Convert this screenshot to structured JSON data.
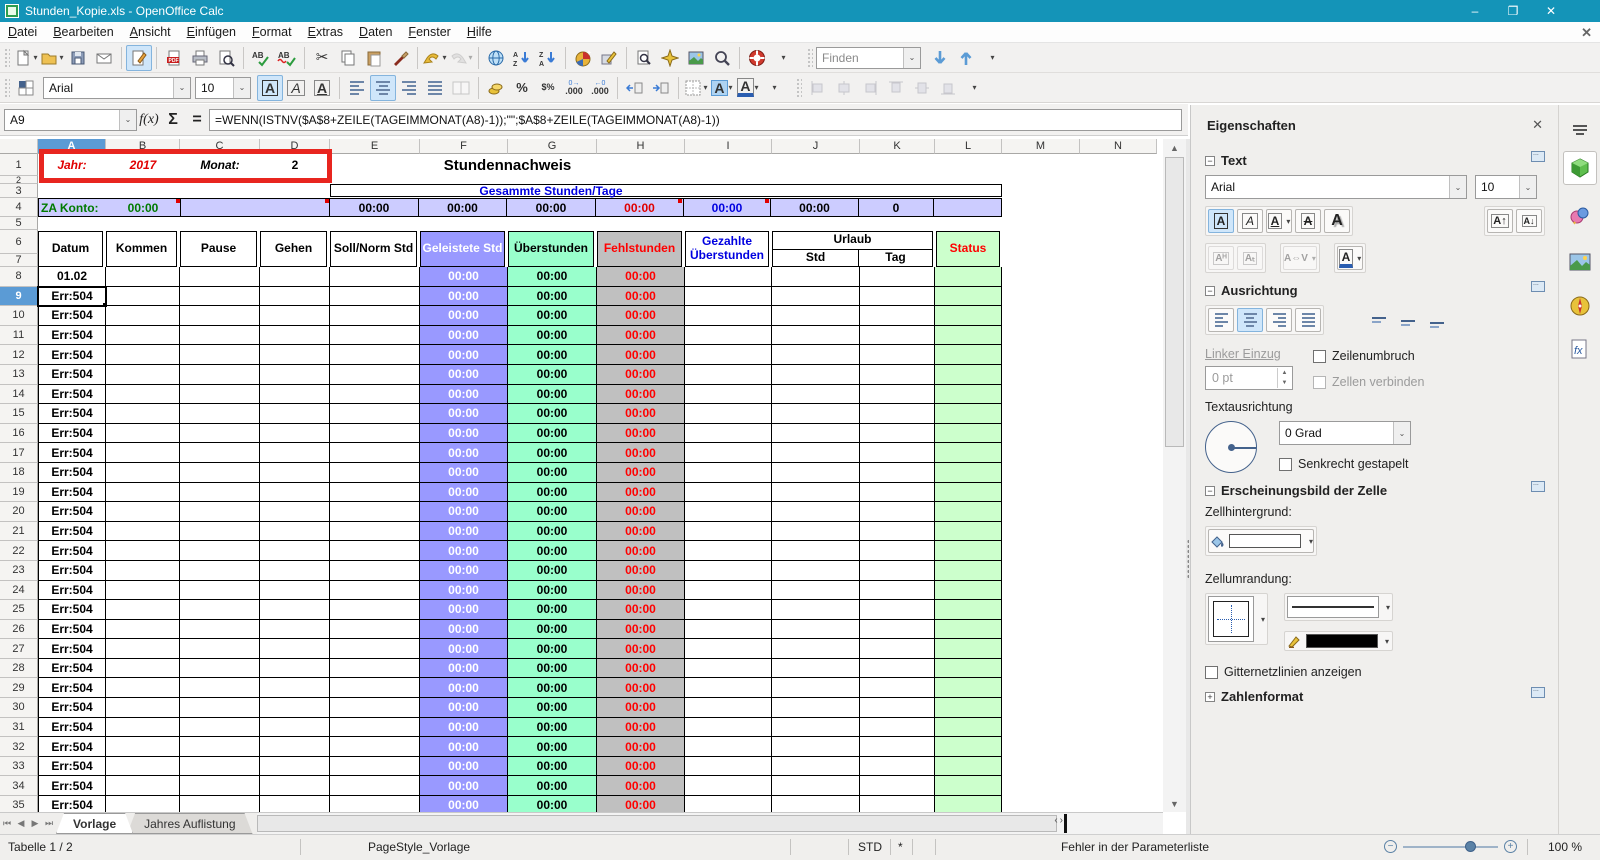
{
  "window": {
    "title": "Stunden_Kopie.xls - OpenOffice Calc",
    "minimize": "–",
    "restore": "❐",
    "close": "✕"
  },
  "menu": {
    "items": [
      "Datei",
      "Bearbeiten",
      "Ansicht",
      "Einfügen",
      "Format",
      "Extras",
      "Daten",
      "Fenster",
      "Hilfe"
    ],
    "doc_close": "✕"
  },
  "standard_toolbar_icons": [
    "new-document",
    "open",
    "save",
    "email",
    "edit-file",
    "export-pdf",
    "print",
    "page-preview",
    "spellcheck",
    "auto-spellcheck",
    "cut",
    "copy",
    "paste",
    "format-paintbrush",
    "undo",
    "redo",
    "hyperlink",
    "sort-ascending",
    "sort-descending",
    "insert-chart",
    "draw-functions",
    "find-replace",
    "navigator",
    "gallery",
    "zoom",
    "help"
  ],
  "find_toolbar": {
    "placeholder": "Finden",
    "find_down": "find-down-arrow",
    "find_up": "find-up-arrow"
  },
  "formatting": {
    "font_name": "Arial",
    "font_size": "10",
    "bold": "A",
    "italic": "A",
    "underline": "A",
    "percent": "%",
    "standard_format": "$%",
    "add_decimal": ".000",
    "del_decimal": ".000",
    "bg_color_letter": "A",
    "font_color_letter": "A"
  },
  "formula_bar": {
    "cell_reference": "A9",
    "fx": "f(x)",
    "sum": "Σ",
    "equals": "=",
    "formula": "=WENN(ISTNV($A$8+ZEILE(TAGEIMMONAT(A8)-1));\"\";$A$8+ZEILE(TAGEIMMONAT(A8)-1))"
  },
  "columns": [
    "A",
    "B",
    "C",
    "D",
    "E",
    "F",
    "G",
    "H",
    "I",
    "J",
    "K",
    "L",
    "M",
    "N"
  ],
  "sheet": {
    "fixed_row_numbers": [
      "1",
      "2",
      "3",
      "4",
      "5",
      "6",
      "7"
    ],
    "title_row": {
      "jahr_label": "Jahr:",
      "jahr_value": "2017",
      "monat_label": "Monat:",
      "monat_value": "2",
      "doc_title": "Stundennachweis"
    },
    "summary": {
      "header": "Gesammte Stunden/Tage",
      "za_label": "ZA Konto:",
      "za_value": "00:00",
      "value_e": "00:00",
      "value_f": "00:00",
      "value_g": "00:00",
      "value_h": "00:00",
      "value_i": "00:00",
      "value_j": "00:00",
      "value_k": "0"
    },
    "table_headers": {
      "datum": "Datum",
      "kommen": "Kommen",
      "pause": "Pause",
      "gehen": "Gehen",
      "soll": "Soll/Norm Std",
      "geleistete": "Geleistete Std",
      "ueberstunden": "Überstunden",
      "fehlstunden": "Fehlstunden",
      "gezahlte": "Gezahlte Überstunden",
      "urlaub": "Urlaub",
      "std": "Std",
      "tag": "Tag",
      "status": "Status"
    },
    "selected_cell": "A9",
    "rows": [
      {
        "n": 8,
        "a": "01.02",
        "f": "00:00",
        "g": "00:00",
        "h": "00:00"
      },
      {
        "n": 9,
        "a": "Err:504",
        "f": "00:00",
        "g": "00:00",
        "h": "00:00"
      },
      {
        "n": 10,
        "a": "Err:504",
        "f": "00:00",
        "g": "00:00",
        "h": "00:00"
      },
      {
        "n": 11,
        "a": "Err:504",
        "f": "00:00",
        "g": "00:00",
        "h": "00:00"
      },
      {
        "n": 12,
        "a": "Err:504",
        "f": "00:00",
        "g": "00:00",
        "h": "00:00"
      },
      {
        "n": 13,
        "a": "Err:504",
        "f": "00:00",
        "g": "00:00",
        "h": "00:00"
      },
      {
        "n": 14,
        "a": "Err:504",
        "f": "00:00",
        "g": "00:00",
        "h": "00:00"
      },
      {
        "n": 15,
        "a": "Err:504",
        "f": "00:00",
        "g": "00:00",
        "h": "00:00"
      },
      {
        "n": 16,
        "a": "Err:504",
        "f": "00:00",
        "g": "00:00",
        "h": "00:00"
      },
      {
        "n": 17,
        "a": "Err:504",
        "f": "00:00",
        "g": "00:00",
        "h": "00:00"
      },
      {
        "n": 18,
        "a": "Err:504",
        "f": "00:00",
        "g": "00:00",
        "h": "00:00"
      },
      {
        "n": 19,
        "a": "Err:504",
        "f": "00:00",
        "g": "00:00",
        "h": "00:00"
      },
      {
        "n": 20,
        "a": "Err:504",
        "f": "00:00",
        "g": "00:00",
        "h": "00:00"
      },
      {
        "n": 21,
        "a": "Err:504",
        "f": "00:00",
        "g": "00:00",
        "h": "00:00"
      },
      {
        "n": 22,
        "a": "Err:504",
        "f": "00:00",
        "g": "00:00",
        "h": "00:00"
      },
      {
        "n": 23,
        "a": "Err:504",
        "f": "00:00",
        "g": "00:00",
        "h": "00:00"
      },
      {
        "n": 24,
        "a": "Err:504",
        "f": "00:00",
        "g": "00:00",
        "h": "00:00"
      },
      {
        "n": 25,
        "a": "Err:504",
        "f": "00:00",
        "g": "00:00",
        "h": "00:00"
      },
      {
        "n": 26,
        "a": "Err:504",
        "f": "00:00",
        "g": "00:00",
        "h": "00:00"
      },
      {
        "n": 27,
        "a": "Err:504",
        "f": "00:00",
        "g": "00:00",
        "h": "00:00"
      },
      {
        "n": 28,
        "a": "Err:504",
        "f": "00:00",
        "g": "00:00",
        "h": "00:00"
      },
      {
        "n": 29,
        "a": "Err:504",
        "f": "00:00",
        "g": "00:00",
        "h": "00:00"
      },
      {
        "n": 30,
        "a": "Err:504",
        "f": "00:00",
        "g": "00:00",
        "h": "00:00"
      },
      {
        "n": 31,
        "a": "Err:504",
        "f": "00:00",
        "g": "00:00",
        "h": "00:00"
      },
      {
        "n": 32,
        "a": "Err:504",
        "f": "00:00",
        "g": "00:00",
        "h": "00:00"
      },
      {
        "n": 33,
        "a": "Err:504",
        "f": "00:00",
        "g": "00:00",
        "h": "00:00"
      },
      {
        "n": 34,
        "a": "Err:504",
        "f": "00:00",
        "g": "00:00",
        "h": "00:00"
      },
      {
        "n": 35,
        "a": "Err:504",
        "f": "00:00",
        "g": "00:00",
        "h": "00:00"
      }
    ]
  },
  "tabs": {
    "sheets": [
      "Vorlage",
      "Jahres Auflistung"
    ],
    "active": "Vorlage"
  },
  "statusbar": {
    "sheet_info": "Tabelle 1 / 2",
    "page_style": "PageStyle_Vorlage",
    "selection_mode": "STD",
    "modified_flag": "*",
    "message": "Fehler in der Parameterliste",
    "zoom_level": "100 %"
  },
  "sidebar": {
    "title": "Eigenschaften",
    "close": "✕",
    "sections": {
      "text": "Text",
      "alignment": "Ausrichtung",
      "cell_appearance": "Erscheinungsbild der Zelle",
      "number_format": "Zahlenformat"
    },
    "font_name": "Arial",
    "font_size": "10",
    "left_indent_label": "Linker Einzug",
    "left_indent_value": "0 pt",
    "wrap_text_label": "Zeilenumbruch",
    "merge_cells_label": "Zellen verbinden",
    "text_orientation_label": "Textausrichtung",
    "rotation_value": "0 Grad",
    "stacked_label": "Senkrecht gestapelt",
    "cell_background_label": "Zellhintergrund:",
    "cell_border_label": "Zellumrandung:",
    "show_gridlines_label": "Gitternetzlinien anzeigen"
  },
  "colors": {
    "titlebar": "#1494b8",
    "lavender": "#ccccff",
    "purple_cells": "#9999ff",
    "mint_cells": "#99ffcc",
    "gray_cells": "#c0c0c0",
    "status_cells": "#ccffcc",
    "red_text": "#ff0000",
    "green_text": "#008000",
    "blue_text": "#0000ff",
    "selection": "#5b9bd5",
    "red_box": "#e8251f"
  }
}
